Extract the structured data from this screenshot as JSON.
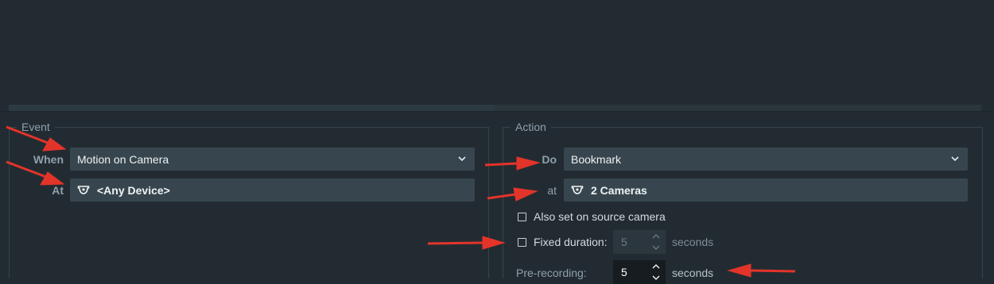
{
  "event": {
    "title": "Event",
    "when_label": "When",
    "when_value": "Motion on Camera",
    "at_label": "At",
    "at_value": "<Any Device>"
  },
  "action": {
    "title": "Action",
    "do_label": "Do",
    "do_value": "Bookmark",
    "at_label": "at",
    "at_value": "2 Cameras",
    "also_set_label": "Also set on source camera",
    "fixed_duration_label": "Fixed duration:",
    "fixed_duration_value": "5",
    "fixed_duration_unit": "seconds",
    "pre_recording_label": "Pre-recording:",
    "pre_recording_value": "5",
    "pre_recording_unit": "seconds"
  },
  "icons": {
    "camera": "camera-icon",
    "dropdown": "chevron-down-icon",
    "spin": "spin-arrows-icon",
    "annotation": "red-arrow-annotation"
  },
  "colors": {
    "background": "#232b32",
    "field": "#37464e",
    "annotation": "#e3342a"
  }
}
